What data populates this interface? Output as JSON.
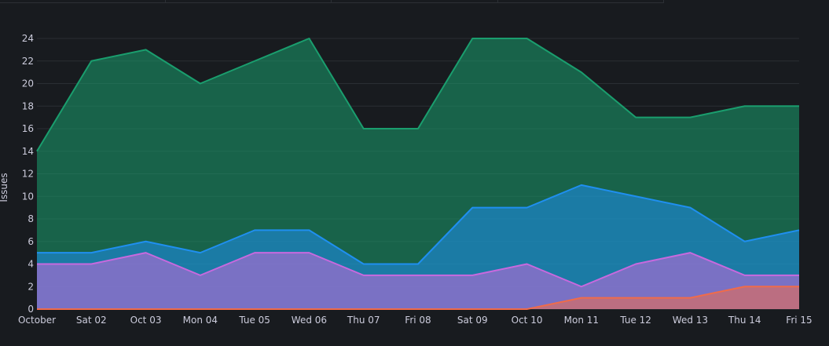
{
  "chart_data": {
    "type": "area",
    "stacked": false,
    "ylabel": "Issues",
    "xlabel": "",
    "ylim": [
      0,
      24
    ],
    "y_ticks": [
      0,
      2,
      4,
      6,
      8,
      10,
      12,
      14,
      16,
      18,
      20,
      22,
      24
    ],
    "categories": [
      "October",
      "Sat 02",
      "Oct 03",
      "Mon 04",
      "Tue 05",
      "Wed 06",
      "Thu 07",
      "Fri 08",
      "Sat 09",
      "Oct 10",
      "Mon 11",
      "Tue 12",
      "Wed 13",
      "Thu 14",
      "Fri 15"
    ],
    "grid": true,
    "legend": "none",
    "series": [
      {
        "color": "#1a9e6e",
        "values": [
          14,
          22,
          23,
          20,
          22,
          24,
          16,
          16,
          24,
          24,
          21,
          17,
          17,
          18,
          18
        ]
      },
      {
        "color": "#1f8ff0",
        "values": [
          5,
          5,
          6,
          5,
          7,
          7,
          4,
          4,
          9,
          9,
          11,
          10,
          9,
          6,
          7
        ]
      },
      {
        "color": "#c869de",
        "values": [
          4,
          4,
          5,
          3,
          5,
          5,
          3,
          3,
          3,
          4,
          2,
          4,
          5,
          3,
          3
        ]
      },
      {
        "color": "#f06b4a",
        "values": [
          0,
          0,
          0,
          0,
          0,
          0,
          0,
          0,
          0,
          0,
          1,
          1,
          1,
          2,
          2
        ]
      }
    ]
  }
}
